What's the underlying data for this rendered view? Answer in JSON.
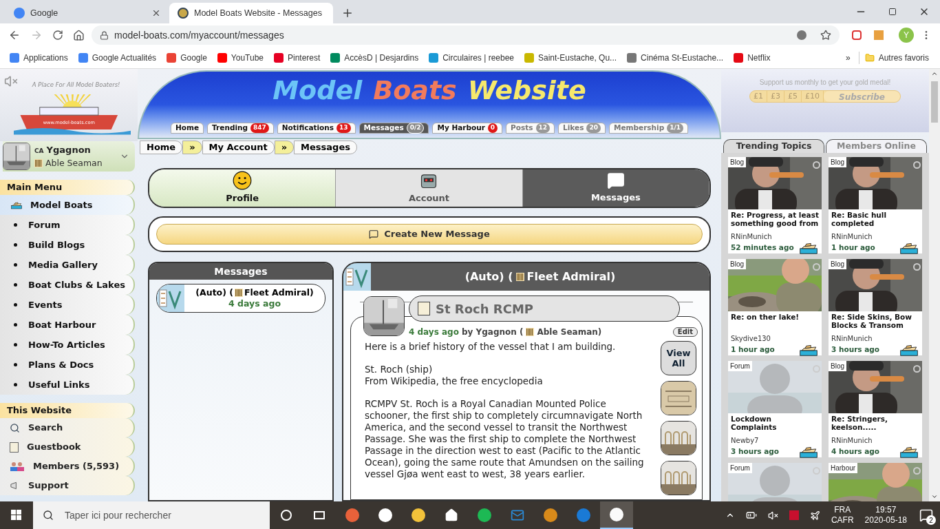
{
  "browser": {
    "tabs": [
      {
        "title": "Google",
        "selected": false
      },
      {
        "title": "Model Boats Website - Messages",
        "selected": true
      }
    ],
    "url": "model-boats.com/myaccount/messages",
    "profile_initial": "Y",
    "bookmarks": [
      "Applications",
      "Google Actualités",
      "Google",
      "YouTube",
      "Pinterest",
      "AccèsD | Desjardins",
      "Circulaires | reebee",
      "Saint-Eustache, Qu...",
      "Cinéma St-Eustache...",
      "Netflix"
    ],
    "more": "»",
    "other_bookmarks": "Autres favoris"
  },
  "header": {
    "logo_tagline": "A Place For All Model Boaters!",
    "logo_url": "www.model-boats.com",
    "title_words": [
      {
        "text": "Model",
        "color": "#6cc4f7"
      },
      {
        "text": "Boats",
        "color": "#f27b5c"
      },
      {
        "text": "Website",
        "color": "#f6e86c"
      }
    ],
    "nav": [
      {
        "label": "Home",
        "selected": false,
        "dimmed": false
      },
      {
        "label": "Trending",
        "badge": "847",
        "alert": true,
        "selected": false,
        "dimmed": false
      },
      {
        "label": "Notifications",
        "badge": "13",
        "alert": true,
        "selected": false,
        "dimmed": false
      },
      {
        "label": "Messages",
        "badge": "0/2",
        "alert": false,
        "selected": true,
        "dimmed": false
      },
      {
        "label": "My Harbour",
        "badge": "0",
        "alert": true,
        "selected": false,
        "dimmed": false
      },
      {
        "label": "Posts",
        "badge": "12",
        "alert": false,
        "selected": false,
        "dimmed": true
      },
      {
        "label": "Likes",
        "badge": "20",
        "alert": false,
        "selected": false,
        "dimmed": true
      },
      {
        "label": "Membership",
        "badge": "1/1",
        "alert": false,
        "selected": false,
        "dimmed": true
      }
    ],
    "support": {
      "text": "Support us monthly to get your gold medal!",
      "amounts": [
        "£1",
        "£3",
        "£5",
        "£10"
      ],
      "subscribe": "Subscribe"
    }
  },
  "user": {
    "country": "CA",
    "name": "Ygagnon",
    "rank": "Able Seaman"
  },
  "breadcrumb": [
    {
      "kind": "link",
      "text": "Home"
    },
    {
      "kind": "separator",
      "text": "»"
    },
    {
      "kind": "link",
      "text": "My Account"
    },
    {
      "kind": "separator",
      "text": "»"
    },
    {
      "kind": "current",
      "text": "Messages"
    }
  ],
  "main_menu": {
    "title": "Main Menu",
    "items": [
      {
        "label": "Model Boats",
        "kind": "boat",
        "selected": true
      },
      {
        "label": "Forum",
        "kind": "bullet",
        "selected": false
      },
      {
        "label": "Build Blogs",
        "kind": "bullet",
        "selected": false
      },
      {
        "label": "Media Gallery",
        "kind": "bullet",
        "selected": false
      },
      {
        "label": "Boat Clubs & Lakes",
        "kind": "bullet",
        "selected": false
      },
      {
        "label": "Events",
        "kind": "bullet",
        "selected": false
      },
      {
        "label": "Boat Harbour",
        "kind": "bullet",
        "selected": false
      },
      {
        "label": "How-To Articles",
        "kind": "bullet",
        "selected": false
      },
      {
        "label": "Plans & Docs",
        "kind": "bullet",
        "selected": false
      },
      {
        "label": "Useful Links",
        "kind": "bullet",
        "selected": false
      }
    ]
  },
  "this_website": {
    "title": "This Website",
    "items": [
      {
        "label": "Search",
        "kind": "search"
      },
      {
        "label": "Guestbook",
        "kind": "guestbook"
      },
      {
        "label": "Members (5,593)",
        "kind": "members"
      },
      {
        "label": "Support",
        "kind": "support"
      }
    ]
  },
  "account_tabs": [
    {
      "label": "Profile",
      "kind": "smiley",
      "selected": false
    },
    {
      "label": "Account",
      "kind": "robot",
      "selected": false
    },
    {
      "label": "Messages",
      "kind": "bubble",
      "selected": true
    }
  ],
  "create_button": "Create New Message",
  "messages_panel": {
    "title": "Messages",
    "items": [
      {
        "prefix": "(Auto) (",
        "rank": "Fleet Admiral)",
        "time": "4 days ago",
        "selected": true
      }
    ]
  },
  "thread": {
    "prefix": "(Auto) (",
    "rank": "Fleet Admiral)",
    "subject": "St Roch RCMP",
    "time": "4 days ago",
    "by": "by Ygagnon (",
    "author_rank": "Able Seaman)",
    "edit": "Edit",
    "view_all": "View All",
    "paragraphs": [
      [
        "Here is a brief history of the vessel that I am building."
      ],
      [
        "St. Roch (ship)",
        "From Wikipedia, the free encyclopedia"
      ],
      [
        "RCMPV St. Roch is a Royal Canadian Mounted Police schooner, the first ship to completely circumnavigate North America, and the second vessel to transit the Northwest Passage. She was the first ship to complete the Northwest Passage in the direction west to east (Pacific to the Atlantic Ocean), going the same route that Amundsen on the sailing vessel Gjøa went east to west, 38 years earlier."
      ]
    ]
  },
  "side_panel": {
    "tabs": [
      {
        "label": "Trending Topics",
        "selected": true
      },
      {
        "label": "Members Online",
        "selected": false
      }
    ],
    "cards": [
      {
        "category": "Blog",
        "title": "Re: Progress, at least something good from",
        "author": "RNinMunich",
        "time": "52 minutes ago"
      },
      {
        "category": "Blog",
        "title": "Re: Basic hull completed",
        "author": "RNinMunich",
        "time": "1 hour ago"
      },
      {
        "category": "Blog",
        "title": "Re: on ther lake!",
        "author": "Skydive130",
        "time": "1 hour ago"
      },
      {
        "category": "Blog",
        "title": "Re: Side Skins, Bow Blocks & Transom",
        "author": "RNinMunich",
        "time": "3 hours ago"
      },
      {
        "category": "Forum",
        "title": "Lockdown Complaints",
        "author": "Newby7",
        "time": "3 hours ago"
      },
      {
        "category": "Blog",
        "title": "Re: Stringers, keelson.....",
        "author": "RNinMunich",
        "time": "4 hours ago"
      },
      {
        "category": "Forum"
      },
      {
        "category": "Harbour"
      }
    ]
  },
  "taskbar": {
    "search_placeholder": "Taper ici pour rechercher",
    "language": "FRA",
    "layout": "CAFR",
    "time": "19:57",
    "date": "2020-05-18",
    "notifications": "2"
  }
}
